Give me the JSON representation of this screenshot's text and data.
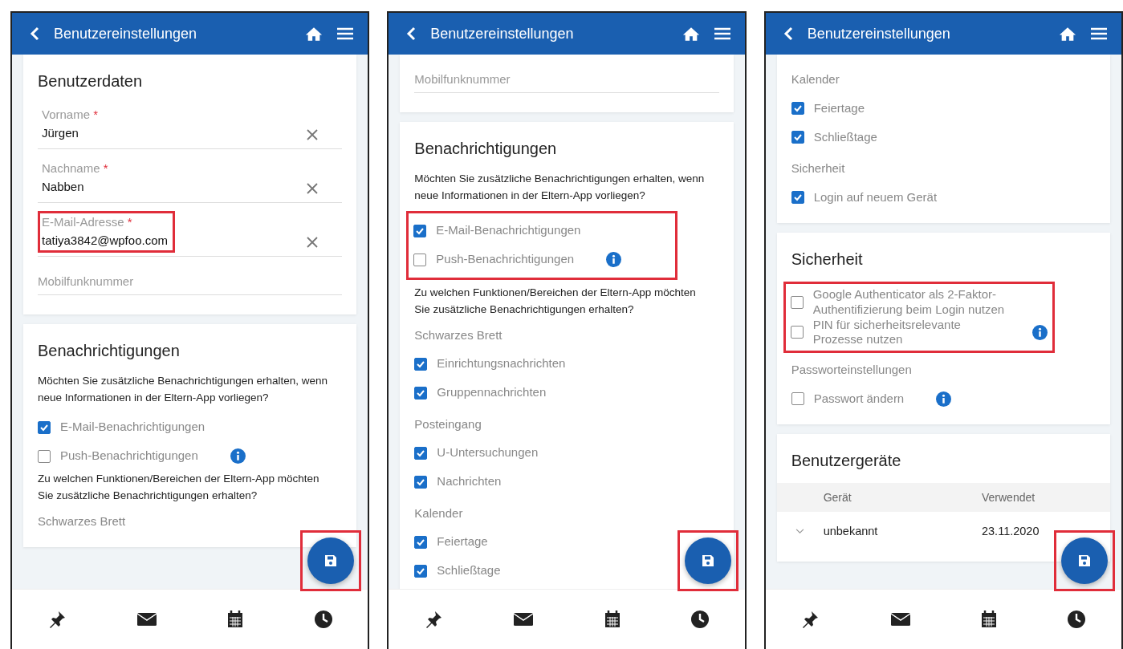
{
  "screens": [
    {
      "title": "Benutzereinstellungen",
      "fab": {
        "highlighted": true
      },
      "cards": [
        {
          "blocks": [
            {
              "kind": "title",
              "text": "Benutzerdaten"
            },
            {
              "kind": "field",
              "label": "Vorname",
              "required_mark": "*",
              "value": "Jürgen"
            },
            {
              "kind": "field",
              "label": "Nachname",
              "required_mark": "*",
              "value": "Nabben"
            },
            {
              "kind": "field",
              "label": "E-Mail-Adresse",
              "required_mark": "*",
              "value": "tatiya3842@wpfoo.com",
              "highlighted": true
            },
            {
              "kind": "field",
              "placeholder": "Mobilfunknummer"
            }
          ]
        },
        {
          "blocks": [
            {
              "kind": "title",
              "text": "Benachrichtigungen"
            },
            {
              "kind": "text",
              "text": "Möchten Sie zusätzliche Benachrichtigungen erhalten, wenn neue Informationen in der Eltern-App vorliegen?"
            },
            {
              "kind": "check",
              "label": "E-Mail-Benachrichtigungen",
              "checked": true
            },
            {
              "kind": "check",
              "label": "Push-Benachrichtigungen",
              "checked": false,
              "info": true
            },
            {
              "kind": "text",
              "text": "Zu welchen Funktionen/Bereichen der Eltern-App möchten Sie zusätzliche Benachrichtigungen erhalten?"
            },
            {
              "kind": "group",
              "text": "Schwarzes Brett"
            }
          ]
        }
      ]
    },
    {
      "title": "Benutzereinstellungen",
      "fab": {
        "highlighted": true
      },
      "cards": [
        {
          "blocks": [
            {
              "kind": "field",
              "placeholder": "Mobilfunknummer"
            }
          ]
        },
        {
          "blocks": [
            {
              "kind": "title",
              "text": "Benachrichtigungen"
            },
            {
              "kind": "text",
              "text": "Möchten Sie zusätzliche Benachrichtigungen erhalten, wenn neue Informationen in der Eltern-App vorliegen?"
            },
            {
              "kind": "highlight",
              "items": [
                {
                  "kind": "check",
                  "label": "E-Mail-Benachrichtigungen",
                  "checked": true
                },
                {
                  "kind": "check",
                  "label": "Push-Benachrichtigungen",
                  "checked": false,
                  "info": true
                }
              ]
            },
            {
              "kind": "text",
              "text": "Zu welchen Funktionen/Bereichen der Eltern-App möchten Sie zusätzliche Benachrichtigungen erhalten?"
            },
            {
              "kind": "group",
              "text": "Schwarzes Brett"
            },
            {
              "kind": "check",
              "label": "Einrichtungsnachrichten",
              "checked": true
            },
            {
              "kind": "check",
              "label": "Gruppennachrichten",
              "checked": true
            },
            {
              "kind": "group",
              "text": "Posteingang"
            },
            {
              "kind": "check",
              "label": "U-Untersuchungen",
              "checked": true
            },
            {
              "kind": "check",
              "label": "Nachrichten",
              "checked": true
            },
            {
              "kind": "group",
              "text": "Kalender"
            },
            {
              "kind": "check",
              "label": "Feiertage",
              "checked": true
            },
            {
              "kind": "check",
              "label": "Schließtage",
              "checked": true
            }
          ]
        }
      ]
    },
    {
      "title": "Benutzereinstellungen",
      "fab": {
        "highlighted": true
      },
      "cards": [
        {
          "blocks": [
            {
              "kind": "group",
              "text": "Kalender"
            },
            {
              "kind": "check",
              "label": "Feiertage",
              "checked": true
            },
            {
              "kind": "check",
              "label": "Schließtage",
              "checked": true
            },
            {
              "kind": "group",
              "text": "Sicherheit"
            },
            {
              "kind": "check",
              "label": "Login auf neuem Gerät",
              "checked": true
            }
          ]
        },
        {
          "blocks": [
            {
              "kind": "title",
              "text": "Sicherheit"
            },
            {
              "kind": "highlight",
              "items": [
                {
                  "kind": "check",
                  "label": "Google Authenticator als 2-Faktor-Authentifizierung beim Login nutzen",
                  "checked": false
                },
                {
                  "kind": "check",
                  "label": "PIN für sicherheitsrelevante Prozesse nutzen",
                  "checked": false,
                  "info": true
                }
              ]
            },
            {
              "kind": "group",
              "text": "Passworteinstellungen"
            },
            {
              "kind": "check",
              "label": "Passwort ändern",
              "checked": false,
              "info": true
            }
          ]
        },
        {
          "blocks": [
            {
              "kind": "title",
              "text": "Benutzergeräte"
            },
            {
              "kind": "table",
              "columns": [
                "Gerät",
                "Verwendet"
              ],
              "rows": [
                {
                  "expanded": false,
                  "cells": [
                    "unbekannt",
                    "23.11.2020"
                  ]
                }
              ]
            }
          ]
        }
      ]
    }
  ]
}
